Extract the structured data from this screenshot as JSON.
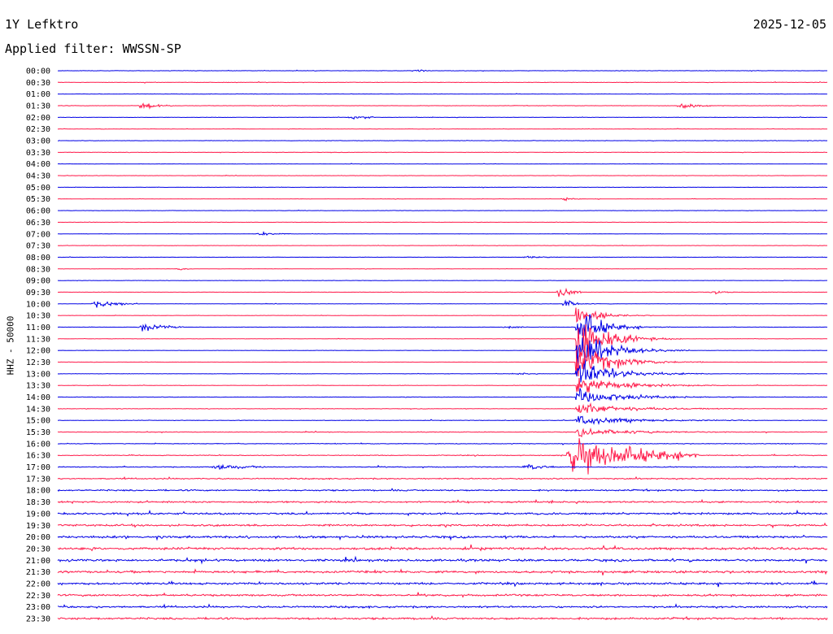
{
  "header": {
    "station": "1Y Lefktro",
    "date": "2025-12-05",
    "filter": "Applied filter: WWSSN-SP"
  },
  "chart_data": {
    "type": "line",
    "title": "1Y Lefktro",
    "subtitle": "Applied filter: WWSSN-SP",
    "ylabel": "HHZ - 50000",
    "categories": [
      "00:00",
      "00:30",
      "01:00",
      "01:30",
      "02:00",
      "02:30",
      "03:00",
      "03:30",
      "04:00",
      "04:30",
      "05:00",
      "05:30",
      "06:00",
      "06:30",
      "07:00",
      "07:30",
      "08:00",
      "08:30",
      "09:00",
      "09:30",
      "10:00",
      "10:30",
      "11:00",
      "11:30",
      "12:00",
      "12:30",
      "13:00",
      "13:30",
      "14:00",
      "14:30",
      "15:00",
      "15:30",
      "16:00",
      "16:30",
      "17:00",
      "17:30",
      "18:00",
      "18:30",
      "19:00",
      "19:30",
      "20:00",
      "20:30",
      "21:00",
      "21:30",
      "22:00",
      "22:30",
      "23:00",
      "23:30"
    ],
    "line_colors": [
      "#0000e6",
      "#ff1a4a"
    ],
    "noise_level": [
      0.06,
      0.07,
      0.06,
      0.06,
      0.06,
      0.06,
      0.06,
      0.06,
      0.05,
      0.05,
      0.05,
      0.05,
      0.05,
      0.05,
      0.05,
      0.05,
      0.05,
      0.05,
      0.05,
      0.05,
      0.05,
      0.05,
      0.05,
      0.05,
      0.05,
      0.05,
      0.06,
      0.06,
      0.07,
      0.07,
      0.08,
      0.09,
      0.1,
      0.12,
      0.14,
      0.18,
      0.22,
      0.25,
      0.28,
      0.3,
      0.33,
      0.35,
      0.35,
      0.34,
      0.32,
      0.3,
      0.28,
      0.3
    ],
    "events": [
      {
        "row": 0,
        "minute": 14.0,
        "amplitude": 0.8,
        "duration": 0.2
      },
      {
        "row": 3,
        "minute": 3.3,
        "amplitude": 1.2,
        "duration": 0.6
      },
      {
        "row": 3,
        "minute": 24.3,
        "amplitude": 1.2,
        "duration": 0.6
      },
      {
        "row": 4,
        "minute": 11.5,
        "amplitude": 0.8,
        "duration": 0.5
      },
      {
        "row": 11,
        "minute": 19.8,
        "amplitude": 0.5,
        "duration": 0.3
      },
      {
        "row": 14,
        "minute": 7.9,
        "amplitude": 0.6,
        "duration": 0.6
      },
      {
        "row": 16,
        "minute": 18.3,
        "amplitude": 0.4,
        "duration": 0.6
      },
      {
        "row": 17,
        "minute": 4.8,
        "amplitude": 0.4,
        "duration": 0.3
      },
      {
        "row": 19,
        "minute": 19.6,
        "amplitude": 2.2,
        "duration": 0.4
      },
      {
        "row": 19,
        "minute": 25.6,
        "amplitude": 0.6,
        "duration": 0.4
      },
      {
        "row": 20,
        "minute": 1.5,
        "amplitude": 1.2,
        "duration": 0.8
      },
      {
        "row": 20,
        "minute": 19.8,
        "amplitude": 1.5,
        "duration": 0.3
      },
      {
        "row": 22,
        "minute": 3.3,
        "amplitude": 1.5,
        "duration": 0.8
      },
      {
        "row": 22,
        "minute": 17.5,
        "amplitude": 0.5,
        "duration": 0.4
      },
      {
        "row": 26,
        "minute": 17.9,
        "amplitude": 0.4,
        "duration": 0.4
      },
      {
        "row": 33,
        "minute": 20.0,
        "amplitude": 6.0,
        "duration": 2.5
      },
      {
        "row": 34,
        "minute": 6.2,
        "amplitude": 0.9,
        "duration": 1.0
      },
      {
        "row": 34,
        "minute": 18.3,
        "amplitude": 1.0,
        "duration": 0.6
      }
    ],
    "large_event": {
      "row": 20,
      "minute": 20.3,
      "peak_amplitude": 9.0,
      "coda_minutes": 2.8,
      "rows_spanned": 12
    }
  }
}
